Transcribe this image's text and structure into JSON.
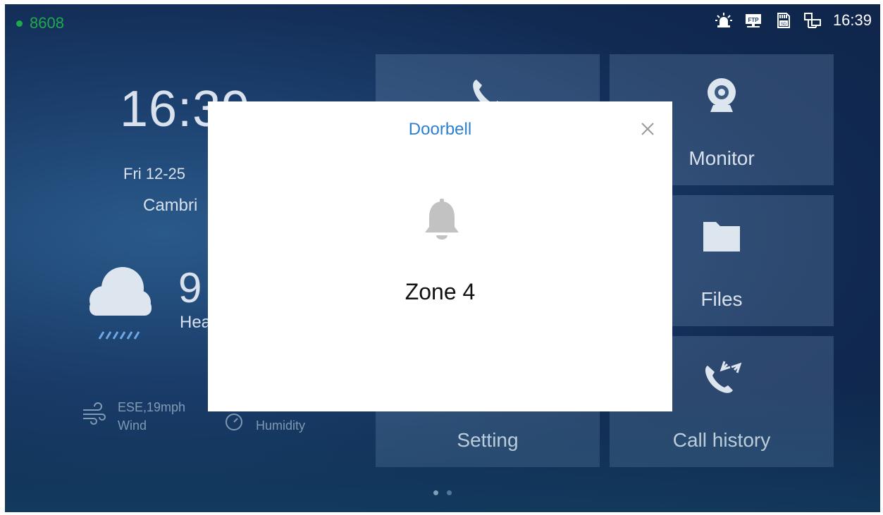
{
  "status_bar": {
    "extension": "8608",
    "time": "16:39",
    "icons": [
      "alarm-light-icon",
      "ftp-icon",
      "sd-card-icon",
      "network-icon"
    ],
    "registered_color": "#1fa84e"
  },
  "home": {
    "clock": "16:39",
    "date": "Fri 12-25",
    "city": "Cambri",
    "temperature": "9",
    "weather_desc": "Hea",
    "wind_value": "ESE,19mph",
    "wind_label": "Wind",
    "humidity_label": "Humidity"
  },
  "tiles": {
    "monitor": "Monitor",
    "files": "Files",
    "setting": "Setting",
    "call_history": "Call history"
  },
  "page_indicator": {
    "pages": 2,
    "current": 1
  },
  "dialog": {
    "title": "Doorbell",
    "zone": "Zone 4",
    "title_color": "#2d7fd0"
  }
}
